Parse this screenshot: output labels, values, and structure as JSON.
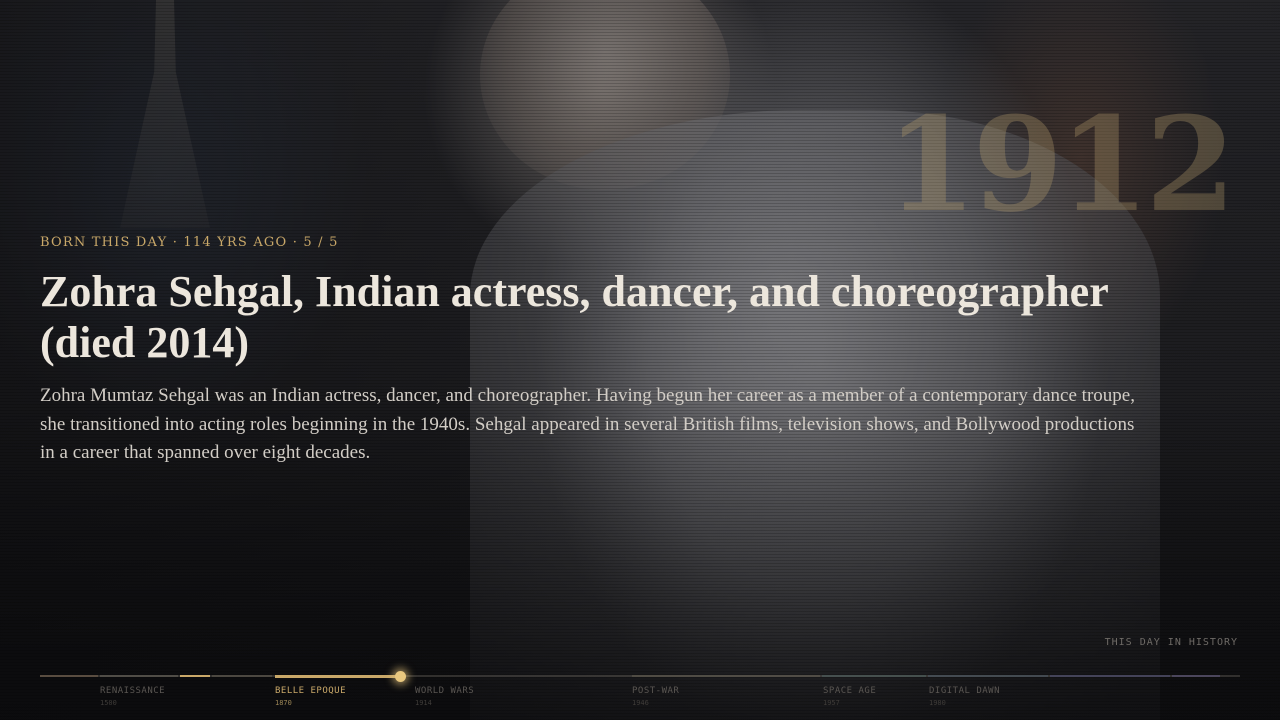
{
  "year_watermark": "1912",
  "eyebrow": "BORN THIS DAY · 114 YRS AGO · 5 / 5",
  "headline": "Zohra Sehgal, Indian actress, dancer, and choreographer (died 2014)",
  "summary": "Zohra Mumtaz Sehgal was an Indian actress, dancer, and choreographer. Having begun her career as a member of a contemporary dance troupe, she transitioned into acting roles beginning in the 1940s. Sehgal appeared in several British films, television shows, and Bollywood productions in a career that spanned over eight decades.",
  "brand": "THIS DAY IN HISTORY",
  "timeline": {
    "eras": [
      {
        "name": "RENAISSANCE",
        "year": "1500",
        "active": false
      },
      {
        "name": "BELLE EPOQUE",
        "year": "1870",
        "active": true
      },
      {
        "name": "WORLD WARS",
        "year": "1914",
        "active": false
      },
      {
        "name": "POST-WAR",
        "year": "1946",
        "active": false
      },
      {
        "name": "SPACE AGE",
        "year": "1957",
        "active": false
      },
      {
        "name": "DIGITAL DAWN",
        "year": "1980",
        "active": false
      }
    ],
    "accent_color": "#c9a869",
    "segment_colors": [
      "#6b5a4a",
      "#5e5a52",
      "#c9a869",
      "#58524a",
      "#5a564c",
      "#4a5a58",
      "#48545e",
      "#4a4a6a",
      "#555070"
    ]
  }
}
